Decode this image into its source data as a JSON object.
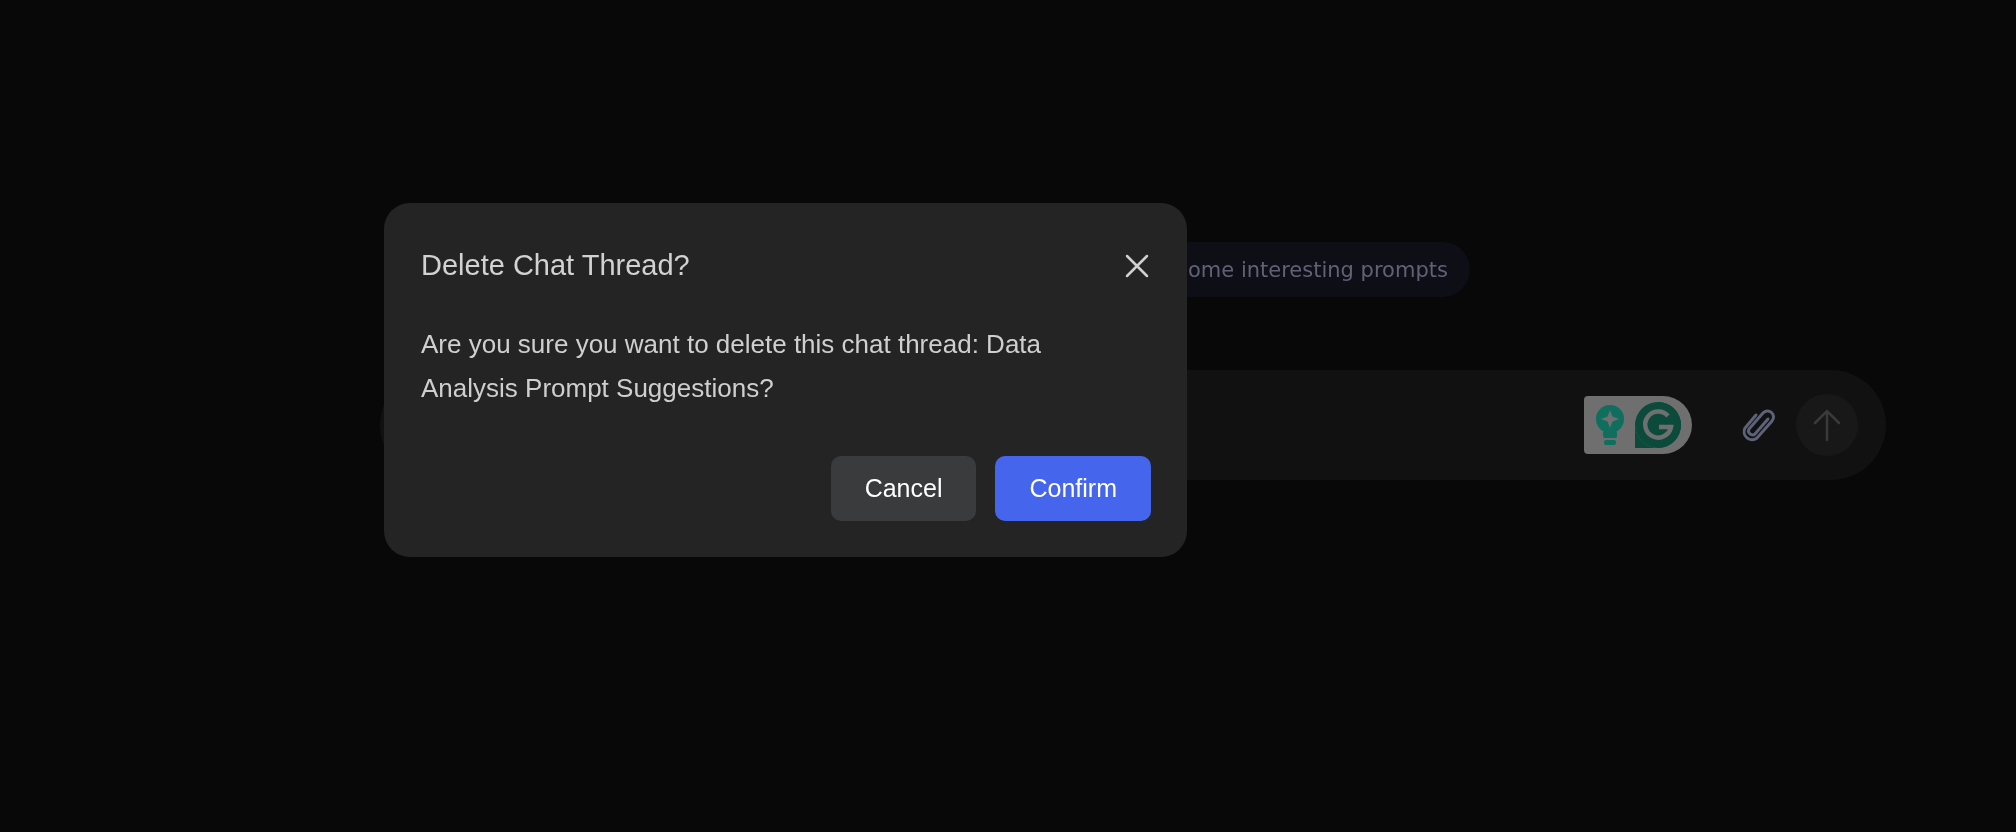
{
  "prompt_chip": {
    "label": "ome interesting prompts"
  },
  "dialog": {
    "title": "Delete Chat Thread?",
    "message": "Are you sure you want to delete this chat thread: Data Analysis Prompt Suggestions?",
    "buttons": [
      {
        "label": "Cancel",
        "kind": "secondary"
      },
      {
        "label": "Confirm",
        "kind": "primary"
      }
    ]
  }
}
